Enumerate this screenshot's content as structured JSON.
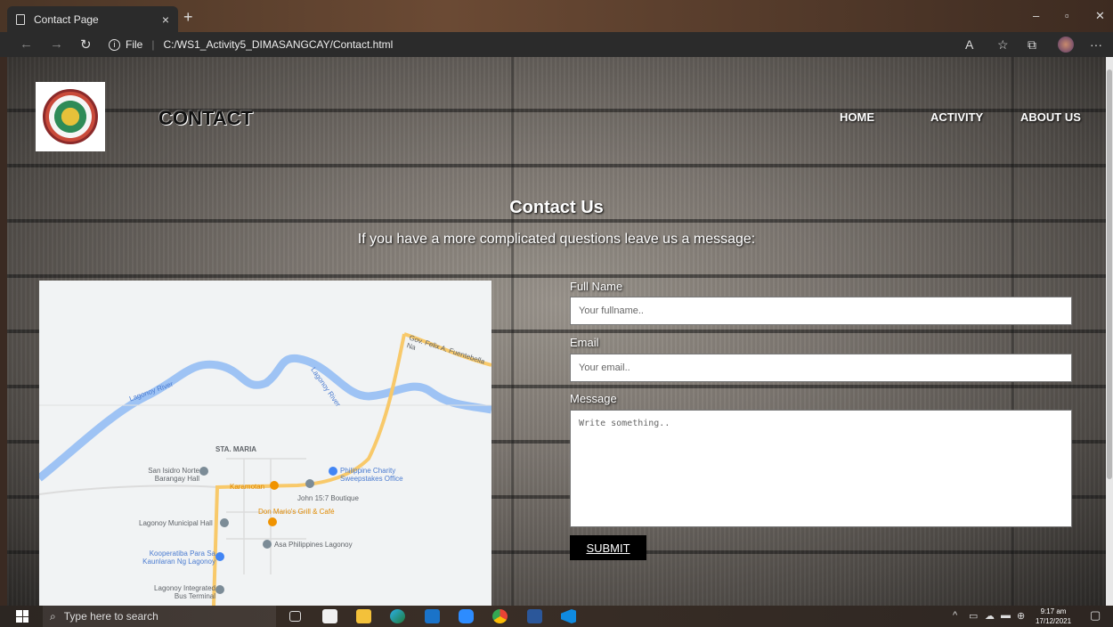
{
  "browser": {
    "tab_title": "Contact Page",
    "tab_close": "×",
    "new_tab": "+",
    "minimize": "–",
    "restore": "▫",
    "close": "✕",
    "url_scheme_label": "File",
    "url": "C:/WS1_Activity5_DIMASANGCAY/Contact.html",
    "back": "←",
    "forward": "→",
    "reload": "↻",
    "more": "···"
  },
  "header": {
    "title": "CONTACT",
    "nav": [
      "HOME",
      "ACTIVITY",
      "ABOUT US"
    ]
  },
  "hero": {
    "heading": "Contact Us",
    "subheading": "If you have a more complicated questions leave us a message:"
  },
  "map": {
    "labels": {
      "lagonoy_river_1": "Lagonoy River",
      "lagonoy_river_2": "Lagonoy River",
      "road": "Gov. Felix A. Fuentebella Na",
      "sta_maria": "STA. MARIA",
      "san_isidro": "San Isidro Norte Barangay Hall",
      "pcso": "Philippine Charity Sweepstakes Office",
      "karamotan": "Karamotan",
      "john157": "John 15:7 Boutique",
      "don_mario": "Don Mario's Grill & Café",
      "municipal_hall": "Lagonoy Municipal Hall",
      "asa": "Asa Philippines Lagonoy",
      "kooperatiba": "Kooperatiba Para Sa Kaunlaran Ng Lagonoy",
      "bus_terminal": "Lagonoy Integrated Bus Terminal"
    }
  },
  "form": {
    "fullname_label": "Full Name",
    "fullname_placeholder": "Your fullname..",
    "email_label": "Email",
    "email_placeholder": "Your email..",
    "message_label": "Message",
    "message_placeholder": "Write something..",
    "submit_label": "SUBMIT"
  },
  "taskbar": {
    "search_placeholder": "Type here to search",
    "time": "9:17 am",
    "date": "17/12/2021"
  },
  "icons": [
    "doc-icon",
    "info-icon",
    "back-icon",
    "forward-icon",
    "reload-icon",
    "favorites-icon",
    "collections-icon",
    "windows-start-icon",
    "search-icon",
    "task-view-icon",
    "store-icon",
    "explorer-icon",
    "edge-icon",
    "mail-icon",
    "zoom-icon",
    "chrome-icon",
    "word-icon",
    "vscode-icon",
    "notification-icon"
  ]
}
